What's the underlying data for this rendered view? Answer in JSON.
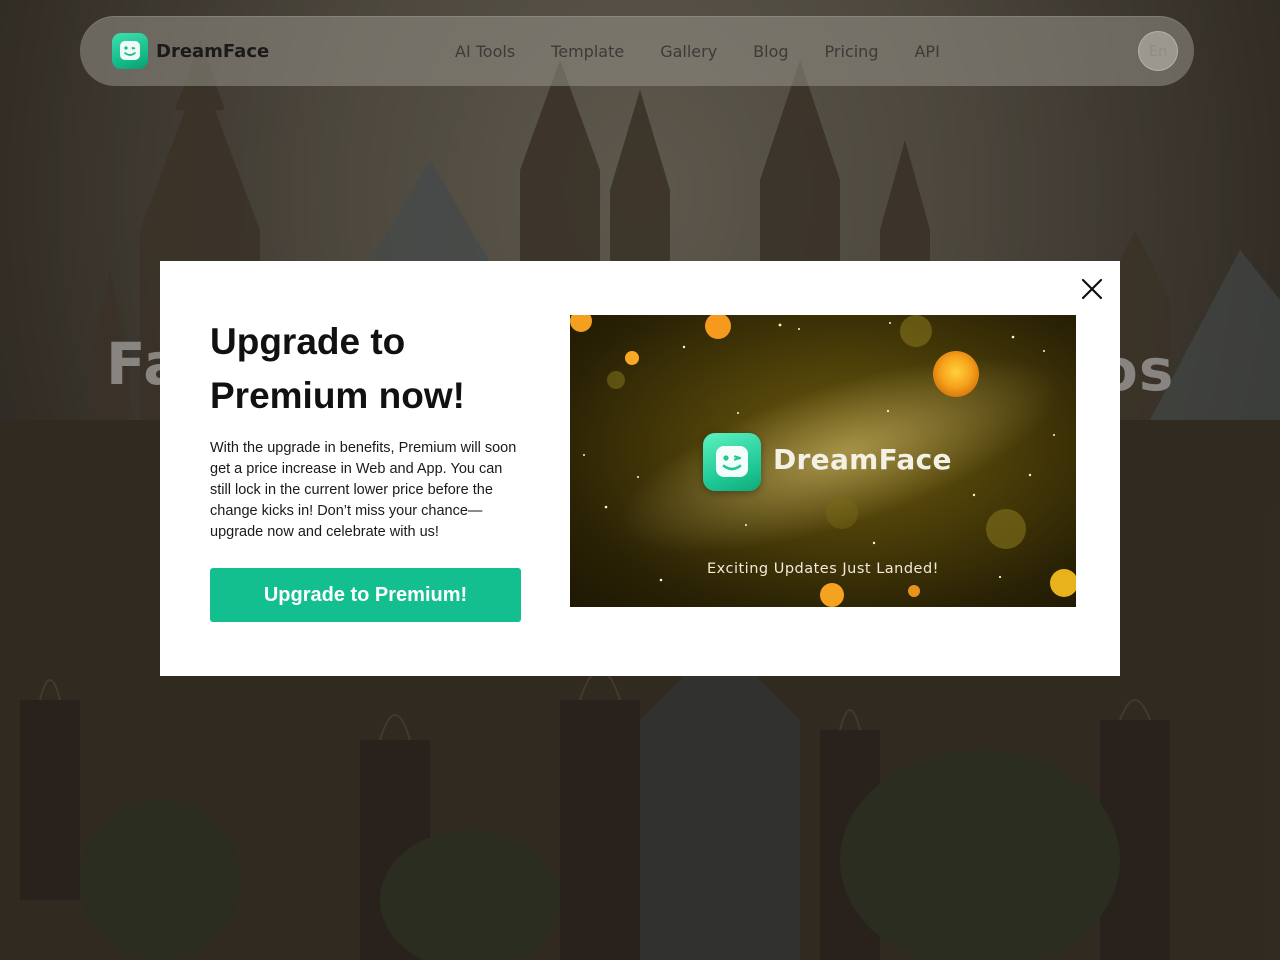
{
  "header": {
    "brand": "DreamFace",
    "nav": [
      "AI Tools",
      "Template",
      "Gallery",
      "Blog",
      "Pricing",
      "API"
    ],
    "lang": "En"
  },
  "hero": {
    "fragment_left": "Fa",
    "fragment_right": "os"
  },
  "modal": {
    "title": "Upgrade to Premium now!",
    "body": "With the upgrade in benefits, Premium will soon get a price increase in Web and App. You can still lock in the current lower price before the change kicks in! Don’t miss your chance—upgrade now and celebrate with us!",
    "cta_label": "Upgrade to Premium!",
    "close_label": "X",
    "promo": {
      "brand": "DreamFace",
      "tagline": "Exciting Updates Just Landed!"
    }
  },
  "colors": {
    "accent": "#14bf8f",
    "modal_bg": "#ffffff"
  },
  "icons": {
    "logo": "dreamface-logo-icon",
    "close": "close-icon"
  }
}
